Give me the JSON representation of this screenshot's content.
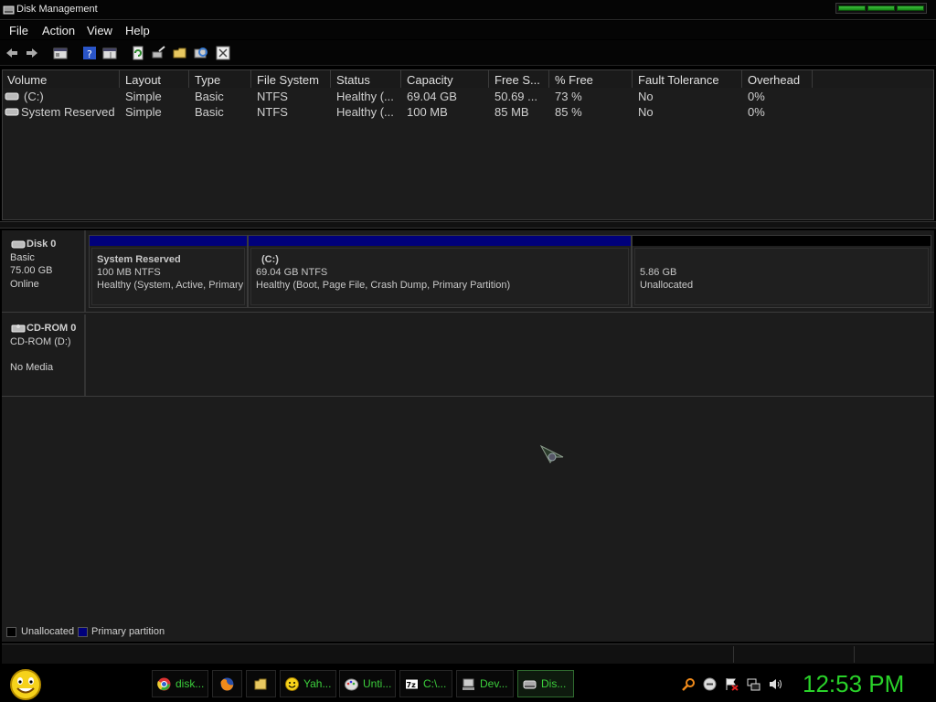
{
  "window": {
    "title": "Disk Management"
  },
  "menu": [
    "File",
    "Action",
    "View",
    "Help"
  ],
  "toolbar_icons": [
    "back-arrow-icon",
    "forward-arrow-icon",
    "console-tree-icon",
    "help-icon",
    "properties-icon",
    "refresh-icon",
    "rescan-icon",
    "open-folder-icon",
    "explore-icon",
    "disk-properties-icon"
  ],
  "volume_table": {
    "columns": [
      "Volume",
      "Layout",
      "Type",
      "File System",
      "Status",
      "Capacity",
      "Free S...",
      "% Free",
      "Fault Tolerance",
      "Overhead"
    ],
    "rows": [
      [
        "(C:)",
        "Simple",
        "Basic",
        "NTFS",
        "Healthy (...",
        "69.04 GB",
        "50.69 ...",
        "73 %",
        "No",
        "0%"
      ],
      [
        "System Reserved",
        "Simple",
        "Basic",
        "NTFS",
        "Healthy (...",
        "100 MB",
        "85 MB",
        "85 %",
        "No",
        "0%"
      ]
    ]
  },
  "disks": {
    "disk0": {
      "name": "Disk 0",
      "type": "Basic",
      "size": "75.00 GB",
      "status": "Online",
      "partitions": [
        {
          "name": "System Reserved",
          "fs": "100 MB NTFS",
          "status": "Healthy (System, Active, Primary"
        },
        {
          "name": "(C:)",
          "fs": "69.04 GB NTFS",
          "status": "Healthy (Boot, Page File, Crash Dump, Primary Partition)"
        },
        {
          "name": "",
          "fs": "5.86 GB",
          "status": "Unallocated"
        }
      ]
    },
    "cdrom0": {
      "name": "CD-ROM 0",
      "drive": "CD-ROM (D:)",
      "media": "No Media"
    }
  },
  "legend": [
    "Unallocated",
    "Primary partition"
  ],
  "colors": {
    "primary_partition": "#00007b",
    "unallocated": "#000000",
    "clock_green": "#29d229"
  },
  "taskbar": {
    "items": [
      {
        "label": "disk...",
        "icon": "chrome-icon"
      },
      {
        "label": "",
        "icon": "firefox-icon"
      },
      {
        "label": "",
        "icon": "folder-icon"
      },
      {
        "label": "Yah...",
        "icon": "yahoo-messenger-icon"
      },
      {
        "label": "Unti...",
        "icon": "paint-icon"
      },
      {
        "label": "C:\\...",
        "icon": "7zip-icon"
      },
      {
        "label": "Dev...",
        "icon": "device-manager-icon"
      },
      {
        "label": "Dis...",
        "icon": "disk-management-icon"
      }
    ],
    "tray_icons": [
      "search-icon",
      "minus-circle-icon",
      "flag-icon",
      "network-icon",
      "volume-icon"
    ],
    "clock": "12:53 PM"
  }
}
